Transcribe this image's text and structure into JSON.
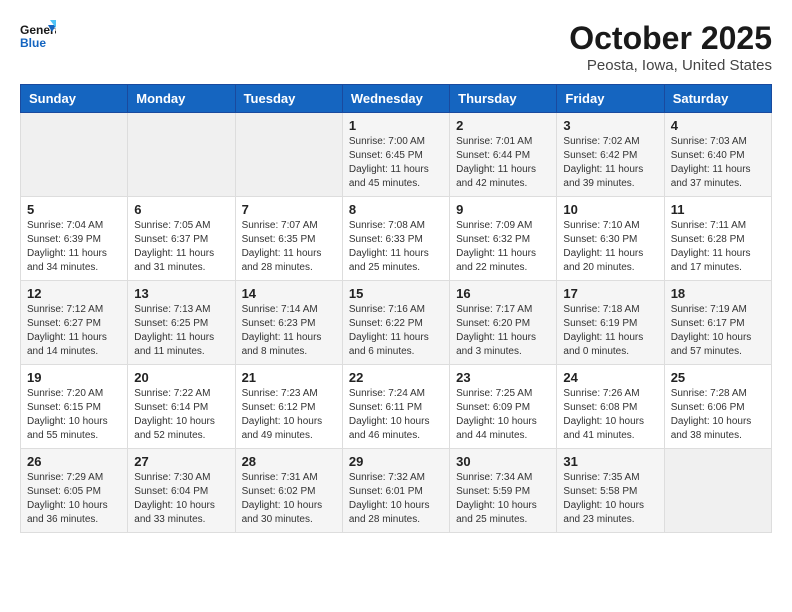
{
  "logo": {
    "general": "General",
    "blue": "Blue"
  },
  "header": {
    "title": "October 2025",
    "subtitle": "Peosta, Iowa, United States"
  },
  "weekdays": [
    "Sunday",
    "Monday",
    "Tuesday",
    "Wednesday",
    "Thursday",
    "Friday",
    "Saturday"
  ],
  "weeks": [
    [
      {
        "day": "",
        "info": ""
      },
      {
        "day": "",
        "info": ""
      },
      {
        "day": "",
        "info": ""
      },
      {
        "day": "1",
        "info": "Sunrise: 7:00 AM\nSunset: 6:45 PM\nDaylight: 11 hours\nand 45 minutes."
      },
      {
        "day": "2",
        "info": "Sunrise: 7:01 AM\nSunset: 6:44 PM\nDaylight: 11 hours\nand 42 minutes."
      },
      {
        "day": "3",
        "info": "Sunrise: 7:02 AM\nSunset: 6:42 PM\nDaylight: 11 hours\nand 39 minutes."
      },
      {
        "day": "4",
        "info": "Sunrise: 7:03 AM\nSunset: 6:40 PM\nDaylight: 11 hours\nand 37 minutes."
      }
    ],
    [
      {
        "day": "5",
        "info": "Sunrise: 7:04 AM\nSunset: 6:39 PM\nDaylight: 11 hours\nand 34 minutes."
      },
      {
        "day": "6",
        "info": "Sunrise: 7:05 AM\nSunset: 6:37 PM\nDaylight: 11 hours\nand 31 minutes."
      },
      {
        "day": "7",
        "info": "Sunrise: 7:07 AM\nSunset: 6:35 PM\nDaylight: 11 hours\nand 28 minutes."
      },
      {
        "day": "8",
        "info": "Sunrise: 7:08 AM\nSunset: 6:33 PM\nDaylight: 11 hours\nand 25 minutes."
      },
      {
        "day": "9",
        "info": "Sunrise: 7:09 AM\nSunset: 6:32 PM\nDaylight: 11 hours\nand 22 minutes."
      },
      {
        "day": "10",
        "info": "Sunrise: 7:10 AM\nSunset: 6:30 PM\nDaylight: 11 hours\nand 20 minutes."
      },
      {
        "day": "11",
        "info": "Sunrise: 7:11 AM\nSunset: 6:28 PM\nDaylight: 11 hours\nand 17 minutes."
      }
    ],
    [
      {
        "day": "12",
        "info": "Sunrise: 7:12 AM\nSunset: 6:27 PM\nDaylight: 11 hours\nand 14 minutes."
      },
      {
        "day": "13",
        "info": "Sunrise: 7:13 AM\nSunset: 6:25 PM\nDaylight: 11 hours\nand 11 minutes."
      },
      {
        "day": "14",
        "info": "Sunrise: 7:14 AM\nSunset: 6:23 PM\nDaylight: 11 hours\nand 8 minutes."
      },
      {
        "day": "15",
        "info": "Sunrise: 7:16 AM\nSunset: 6:22 PM\nDaylight: 11 hours\nand 6 minutes."
      },
      {
        "day": "16",
        "info": "Sunrise: 7:17 AM\nSunset: 6:20 PM\nDaylight: 11 hours\nand 3 minutes."
      },
      {
        "day": "17",
        "info": "Sunrise: 7:18 AM\nSunset: 6:19 PM\nDaylight: 11 hours\nand 0 minutes."
      },
      {
        "day": "18",
        "info": "Sunrise: 7:19 AM\nSunset: 6:17 PM\nDaylight: 10 hours\nand 57 minutes."
      }
    ],
    [
      {
        "day": "19",
        "info": "Sunrise: 7:20 AM\nSunset: 6:15 PM\nDaylight: 10 hours\nand 55 minutes."
      },
      {
        "day": "20",
        "info": "Sunrise: 7:22 AM\nSunset: 6:14 PM\nDaylight: 10 hours\nand 52 minutes."
      },
      {
        "day": "21",
        "info": "Sunrise: 7:23 AM\nSunset: 6:12 PM\nDaylight: 10 hours\nand 49 minutes."
      },
      {
        "day": "22",
        "info": "Sunrise: 7:24 AM\nSunset: 6:11 PM\nDaylight: 10 hours\nand 46 minutes."
      },
      {
        "day": "23",
        "info": "Sunrise: 7:25 AM\nSunset: 6:09 PM\nDaylight: 10 hours\nand 44 minutes."
      },
      {
        "day": "24",
        "info": "Sunrise: 7:26 AM\nSunset: 6:08 PM\nDaylight: 10 hours\nand 41 minutes."
      },
      {
        "day": "25",
        "info": "Sunrise: 7:28 AM\nSunset: 6:06 PM\nDaylight: 10 hours\nand 38 minutes."
      }
    ],
    [
      {
        "day": "26",
        "info": "Sunrise: 7:29 AM\nSunset: 6:05 PM\nDaylight: 10 hours\nand 36 minutes."
      },
      {
        "day": "27",
        "info": "Sunrise: 7:30 AM\nSunset: 6:04 PM\nDaylight: 10 hours\nand 33 minutes."
      },
      {
        "day": "28",
        "info": "Sunrise: 7:31 AM\nSunset: 6:02 PM\nDaylight: 10 hours\nand 30 minutes."
      },
      {
        "day": "29",
        "info": "Sunrise: 7:32 AM\nSunset: 6:01 PM\nDaylight: 10 hours\nand 28 minutes."
      },
      {
        "day": "30",
        "info": "Sunrise: 7:34 AM\nSunset: 5:59 PM\nDaylight: 10 hours\nand 25 minutes."
      },
      {
        "day": "31",
        "info": "Sunrise: 7:35 AM\nSunset: 5:58 PM\nDaylight: 10 hours\nand 23 minutes."
      },
      {
        "day": "",
        "info": ""
      }
    ]
  ]
}
